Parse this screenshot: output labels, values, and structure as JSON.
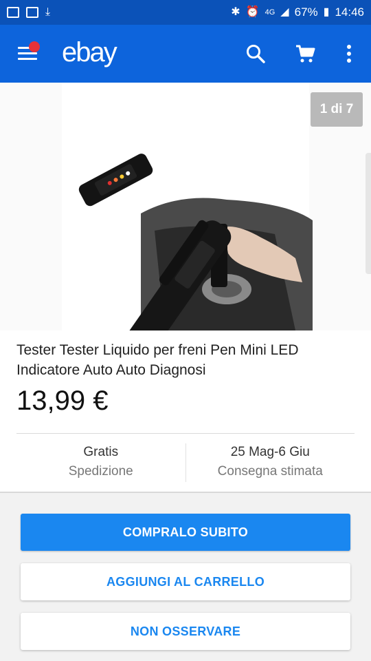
{
  "status_bar": {
    "battery": "67%",
    "time": "14:46",
    "network": "4G"
  },
  "app_bar": {
    "logo": "ebay"
  },
  "image_gallery": {
    "counter": "1 di 7"
  },
  "product": {
    "title": "Tester Tester Liquido per freni Pen Mini LED Indicatore Auto Auto Diagnosi",
    "price": "13,99 €"
  },
  "shipping": {
    "value": "Gratis",
    "label": "Spedizione"
  },
  "delivery": {
    "value": "25 Mag-6 Giu",
    "label": "Consegna stimata"
  },
  "actions": {
    "buy_now": "COMPRALO SUBITO",
    "add_to_cart": "AGGIUNGI AL CARRELLO",
    "unwatch": "NON OSSERVARE"
  }
}
